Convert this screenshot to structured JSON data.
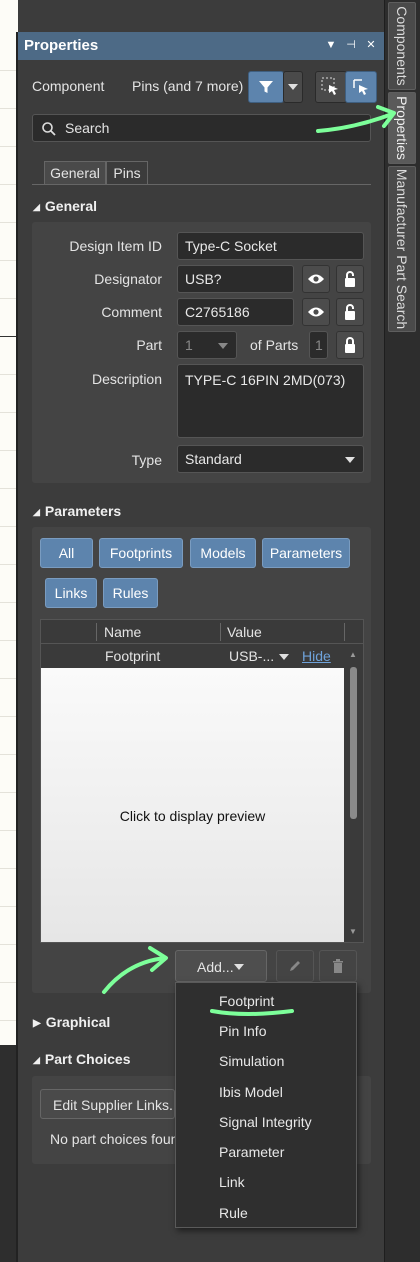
{
  "panel": {
    "title": "Properties"
  },
  "right_tabs": [
    "Components",
    "Properties",
    "Manufacturer Part Search"
  ],
  "filter_bar": {
    "object_label": "Component",
    "selection_label": "Pins (and 7 more)"
  },
  "search": {
    "placeholder": "Search"
  },
  "tabs": [
    "General",
    "Pins"
  ],
  "general": {
    "section_title": "General",
    "design_item_id_label": "Design Item ID",
    "design_item_id_value": "Type-C Socket",
    "designator_label": "Designator",
    "designator_value": "USB?",
    "comment_label": "Comment",
    "comment_value": "C2765186",
    "part_label": "Part",
    "part_value": "1",
    "of_parts_label": "of Parts",
    "of_parts_value": "1",
    "description_label": "Description",
    "description_value": "TYPE-C 16PIN 2MD(073)",
    "type_label": "Type",
    "type_value": "Standard"
  },
  "parameters": {
    "section_title": "Parameters",
    "filters": [
      "All",
      "Footprints",
      "Models",
      "Parameters",
      "Links",
      "Rules"
    ],
    "columns": [
      "Name",
      "Value"
    ],
    "row": {
      "name": "Footprint",
      "value": "USB-...",
      "action": "Hide"
    },
    "preview_text": "Click to display preview",
    "add_label": "Add..."
  },
  "add_menu": [
    "Footprint",
    "Pin Info",
    "Simulation",
    "Ibis Model",
    "Signal Integrity",
    "Parameter",
    "Link",
    "Rule"
  ],
  "graphical": {
    "section_title": "Graphical"
  },
  "part_choices": {
    "section_title": "Part Choices",
    "edit_button": "Edit Supplier Links...",
    "empty_text": "No part choices found"
  },
  "annotation_color": "#7dff9a"
}
